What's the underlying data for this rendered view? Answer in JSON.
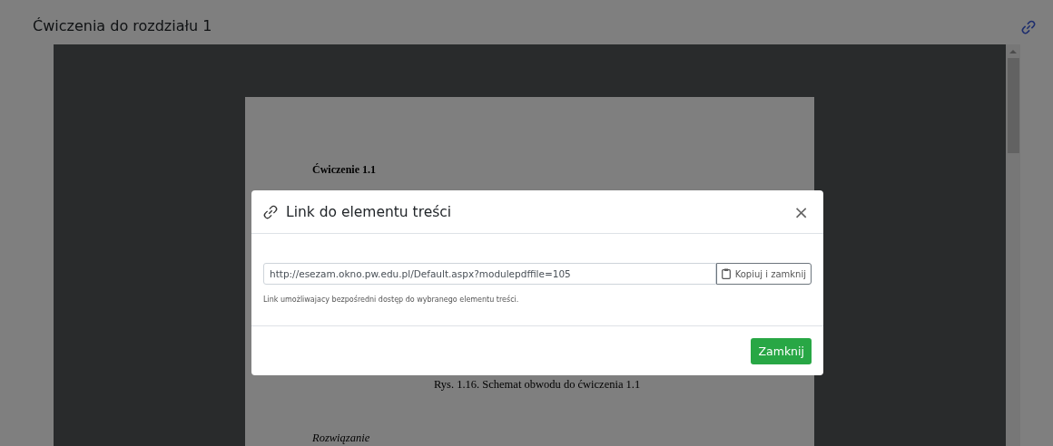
{
  "panel": {
    "title": "Ćwiczenia do rozdziału 1"
  },
  "document": {
    "heading": "Ćwiczenie 1.1",
    "caption": "Rys. 1.16. Schemat obwodu do ćwiczenia 1.1",
    "section": "Rozwiązanie"
  },
  "dialog": {
    "title": "Link do elementu treści",
    "close": "×",
    "url": "http://esezam.okno.pw.edu.pl/Default.aspx?modulepdffile=105",
    "copy_button": "Kopiuj i zamknij",
    "help": "Link umożliwajacy bezpośredni dostęp do wybranego elementu treści.",
    "close_button": "Zamknij"
  }
}
